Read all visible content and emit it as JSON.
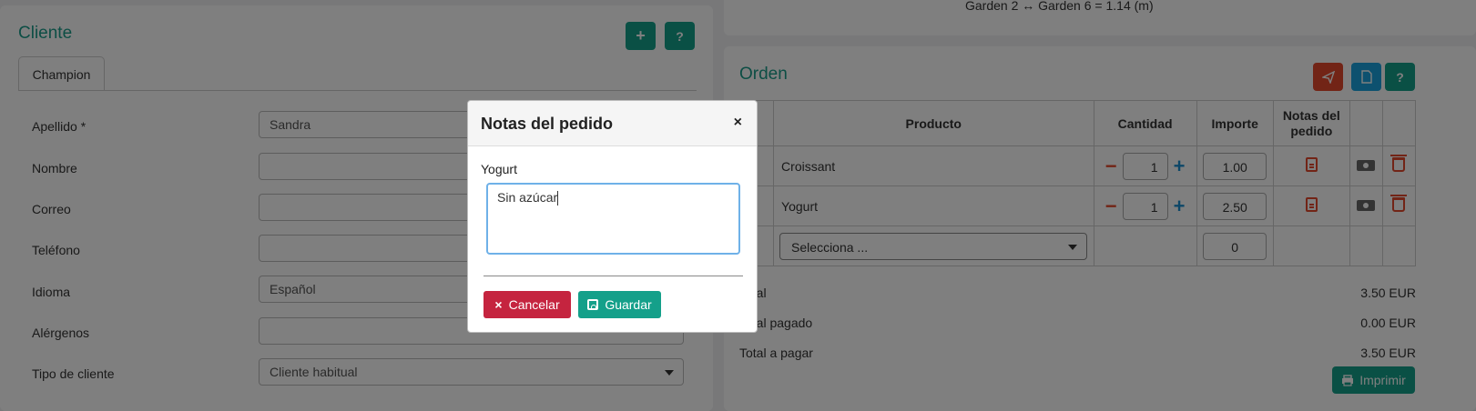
{
  "top_info": {
    "text": "Garden 2 ↔ Garden 6 = 1.14 (m)"
  },
  "client": {
    "title": "Cliente",
    "add_label": "+",
    "help_label": "?",
    "tab": "Champion",
    "fields": {
      "apellido": {
        "label": "Apellido",
        "required": "*",
        "value": "Sandra"
      },
      "nombre": {
        "label": "Nombre",
        "value": ""
      },
      "correo": {
        "label": "Correo",
        "value": ""
      },
      "telefono": {
        "label": "Teléfono",
        "value": ""
      },
      "idioma": {
        "label": "Idioma",
        "value": "Español"
      },
      "alergenos": {
        "label": "Alérgenos",
        "value": ""
      },
      "tipo": {
        "label": "Tipo de cliente",
        "value": "Cliente habitual"
      }
    }
  },
  "order": {
    "title": "Orden",
    "help_label": "?",
    "columns": {
      "producto": "Producto",
      "cantidad": "Cantidad",
      "importe": "Importe",
      "notas": "Notas del pedido"
    },
    "rows": [
      {
        "product": "Croissant",
        "qty": "1",
        "amount": "1.00"
      },
      {
        "product": "Yogurt",
        "qty": "1",
        "amount": "2.50"
      }
    ],
    "new_row": {
      "select_placeholder": "Selecciona ...",
      "amount": "0"
    },
    "totals": {
      "total_label": "Total",
      "total_value": "3.50 EUR",
      "paid_label": "Total pagado",
      "paid_value": "0.00 EUR",
      "to_pay_label": "Total a pagar",
      "to_pay_value": "3.50 EUR"
    },
    "print_label": "Imprimir"
  },
  "modal": {
    "title": "Notas del pedido",
    "close": "×",
    "label": "Yogurt",
    "text": "Sin azúcar",
    "cancel": "Cancelar",
    "cancel_icon": "×",
    "save": "Guardar"
  }
}
